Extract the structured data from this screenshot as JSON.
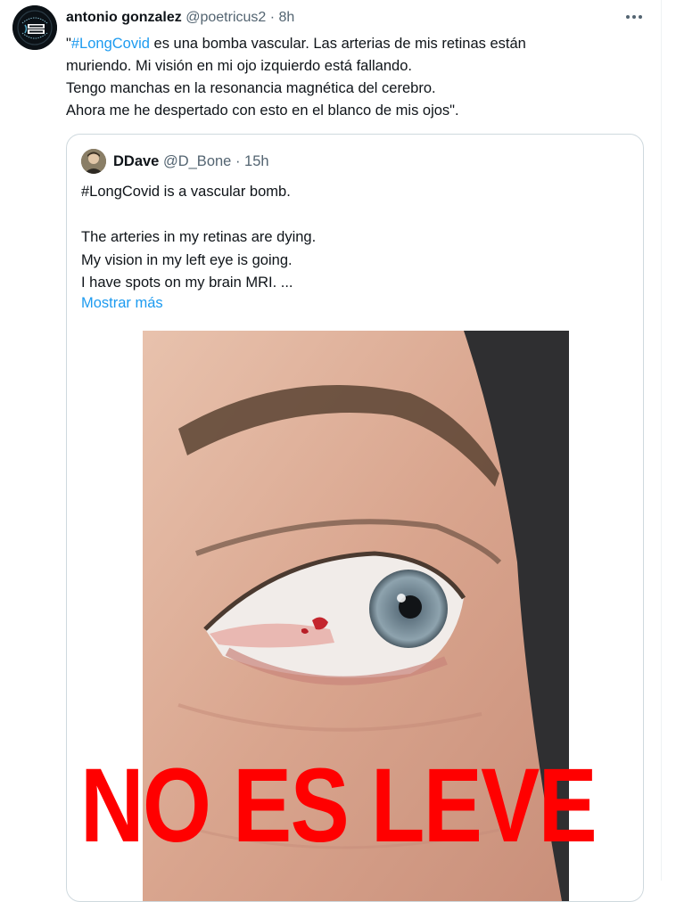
{
  "tweet": {
    "author_name": "antonio gonzalez",
    "author_handle": "@poetricus2",
    "separator": "·",
    "time": "8h",
    "avatar_badge_text": "LONG COVID",
    "avatar_ring_text": "LONG COVID AWARENESS",
    "more_icon": "more-horizontal-icon",
    "text_lines": [
      {
        "prefix": "\"",
        "hashtag": "#LongCovid",
        "rest": " es una bomba vascular. Las arterias de mis retinas están"
      },
      {
        "text": "muriendo. Mi visión en mi ojo izquierdo está fallando."
      },
      {
        "text": "Tengo manchas en la resonancia magnética del cerebro."
      },
      {
        "text": "Ahora me he despertado con esto en el blanco de mis ojos\"."
      }
    ]
  },
  "quoted_tweet": {
    "author_name": "DDave",
    "author_handle": "@D_Bone",
    "separator": "·",
    "time": "15h",
    "lines": [
      "#LongCovid is a vascular bomb.",
      "",
      "The arteries in my retinas are dying.",
      "My vision in my left eye is going.",
      "I have spots on my brain MRI. ..."
    ],
    "show_more": "Mostrar más"
  },
  "overlay": {
    "caption": "NO ES LEVE",
    "color": "#ff0000"
  },
  "colors": {
    "link": "#1d9bf0",
    "secondary_text": "#536471",
    "border": "#cfd9de"
  }
}
